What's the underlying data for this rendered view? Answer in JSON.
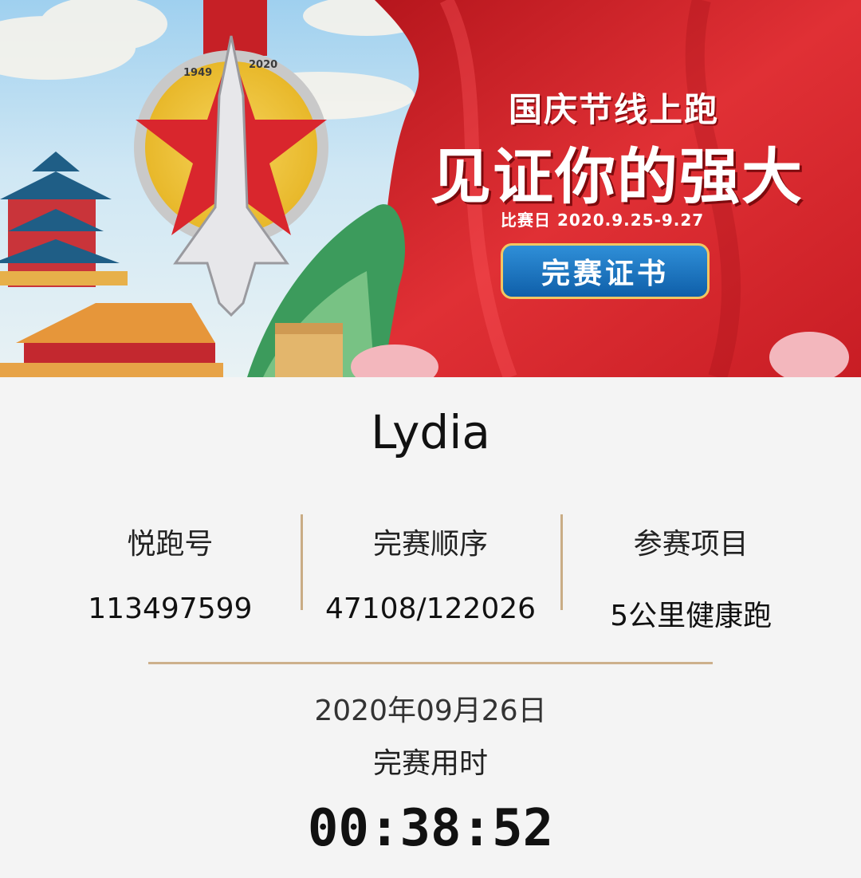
{
  "banner": {
    "subtitle": "国庆节线上跑",
    "headline": "见证你的强大",
    "race_dates": "比赛日 2020.9.25-9.27",
    "certificate_button": "完赛证书",
    "medal_years": [
      "1949",
      "2020"
    ]
  },
  "runner": {
    "name": "Lydia"
  },
  "stats": [
    {
      "label": "悦跑号",
      "value": "113497599"
    },
    {
      "label": "完赛顺序",
      "value": "47108/122026"
    },
    {
      "label": "参赛项目",
      "value": "5公里健康跑"
    }
  ],
  "finish": {
    "date": "2020年09月26日",
    "time_label": "完赛用时",
    "time": "00:38:52"
  },
  "colors": {
    "banner_red": "#d7262b",
    "divider_gold": "#c9ac85",
    "button_blue": "#1b73c0"
  }
}
